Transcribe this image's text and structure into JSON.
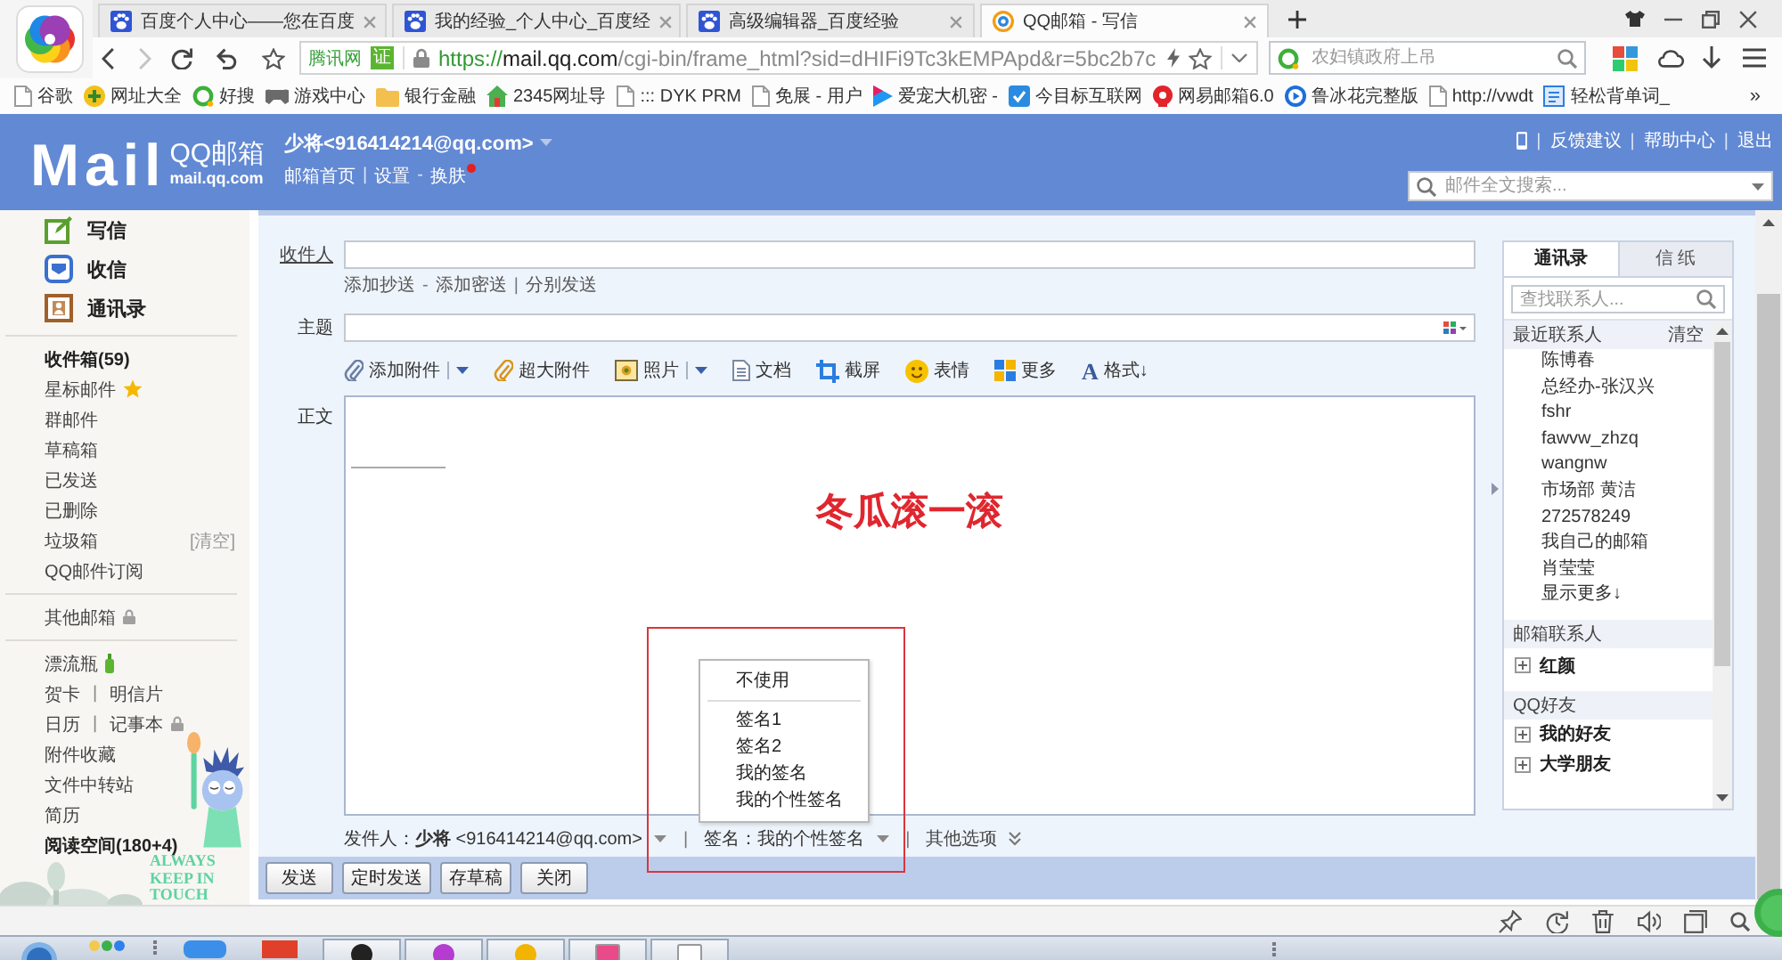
{
  "browser": {
    "tabs": [
      {
        "title": "百度个人中心——您在百度",
        "kind": "paw",
        "selected": false
      },
      {
        "title": "我的经验_个人中心_百度经",
        "kind": "paw",
        "selected": false
      },
      {
        "title": "高级编辑器_百度经验",
        "kind": "paw",
        "selected": false
      },
      {
        "title": "QQ邮箱 - 写信",
        "kind": "ring",
        "selected": true
      }
    ],
    "address": {
      "site_label": "腾讯网",
      "badge": "证",
      "scheme": "https://",
      "host": "mail.qq.com",
      "path": "/cgi-bin/frame_html?sid=dHIFi9Tc3kEMPApd&r=5bc2b7c"
    },
    "search": {
      "placeholder": "农妇镇政府上吊"
    },
    "bookmarks": [
      {
        "label": "谷歌",
        "kind": "page"
      },
      {
        "label": "网址大全",
        "kind": "plus"
      },
      {
        "label": "好搜",
        "kind": "ring"
      },
      {
        "label": "游戏中心",
        "kind": "gamepad"
      },
      {
        "label": "银行金融",
        "kind": "folder"
      },
      {
        "label": "2345网址导",
        "kind": "house"
      },
      {
        "label": "::: DYK PRM",
        "kind": "page"
      },
      {
        "label": "免展 - 用户",
        "kind": "page"
      },
      {
        "label": "爱宠大机密 -",
        "kind": "play"
      },
      {
        "label": "今目标互联网",
        "kind": "tile"
      },
      {
        "label": "网易邮箱6.0",
        "kind": "seal"
      },
      {
        "label": "鲁冰花完整版",
        "kind": "disc"
      },
      {
        "label": "http://vwdt",
        "kind": "page"
      },
      {
        "label": "轻松背单词_",
        "kind": "note"
      }
    ],
    "bookmarks_more": "»"
  },
  "mail_header": {
    "logo": "Mail",
    "brand": "QQ邮箱",
    "domain": "mail.qq.com",
    "account": "少将<916414214@qq.com>",
    "links": [
      {
        "label": "邮箱首页",
        "new": false
      },
      {
        "sep": "|"
      },
      {
        "label": "设置",
        "new": false
      },
      {
        "sep": "-"
      },
      {
        "label": "换肤",
        "new": true
      }
    ],
    "top_links": [
      {
        "sep": "|"
      },
      {
        "label": "反馈建议"
      },
      {
        "sep": "|"
      },
      {
        "label": "帮助中心"
      },
      {
        "sep": "|"
      },
      {
        "label": "退出"
      }
    ],
    "search": {
      "placeholder": "邮件全文搜索..."
    }
  },
  "sidebar": {
    "actions": [
      {
        "label": "写信",
        "kind": "pencil"
      },
      {
        "label": "收信",
        "kind": "inbox"
      },
      {
        "label": "通讯录",
        "kind": "card"
      }
    ],
    "groups": [
      [
        {
          "parts": [
            {
              "label": "收件箱(59)"
            }
          ],
          "kind": "plain",
          "unread": true
        },
        {
          "parts": [
            {
              "label": "星标邮件"
            }
          ],
          "kind": "star",
          "unread": false
        },
        {
          "parts": [
            {
              "label": "群邮件"
            }
          ],
          "kind": "plain",
          "unread": false
        },
        {
          "parts": [
            {
              "label": "草稿箱"
            }
          ],
          "kind": "plain",
          "unread": false
        },
        {
          "parts": [
            {
              "label": "已发送"
            }
          ],
          "kind": "plain",
          "unread": false
        },
        {
          "parts": [
            {
              "label": "已删除"
            }
          ],
          "kind": "plain",
          "unread": false
        },
        {
          "parts": [
            {
              "label": "垃圾箱"
            }
          ],
          "kind": "plain",
          "unread": false,
          "action": "[清空]"
        },
        {
          "parts": [
            {
              "label": "QQ邮件订阅"
            }
          ],
          "kind": "plain",
          "unread": false
        }
      ],
      [
        {
          "parts": [
            {
              "label": "其他邮箱"
            }
          ],
          "kind": "lock",
          "unread": false
        }
      ],
      [
        {
          "parts": [
            {
              "label": "漂流瓶"
            }
          ],
          "kind": "bottle",
          "unread": false
        },
        {
          "parts": [
            {
              "label": "贺卡"
            },
            {
              "sep": "|"
            },
            {
              "label": "明信片"
            }
          ],
          "kind": "plain",
          "unread": false
        },
        {
          "parts": [
            {
              "label": "日历"
            },
            {
              "sep": "|"
            },
            {
              "label": "记事本"
            }
          ],
          "kind": "lock",
          "unread": false
        },
        {
          "parts": [
            {
              "label": "附件收藏"
            }
          ],
          "kind": "plain",
          "unread": false
        },
        {
          "parts": [
            {
              "label": "文件中转站"
            }
          ],
          "kind": "plain",
          "unread": false
        },
        {
          "parts": [
            {
              "label": "简历"
            }
          ],
          "kind": "plain",
          "unread": false
        },
        {
          "parts": [
            {
              "label": "阅读空间(180+4)"
            }
          ],
          "kind": "plain",
          "unread": true
        }
      ]
    ],
    "slogan": "ALWAYS KEEP IN TOUCH"
  },
  "compose": {
    "to_label": "收件人",
    "cc_links": [
      {
        "label": "添加抄送"
      },
      {
        "sep": "-"
      },
      {
        "label": "添加密送"
      },
      {
        "sep": "|"
      },
      {
        "label": "分别发送"
      }
    ],
    "subject_label": "主题",
    "toolbar": [
      {
        "label": "添加附件",
        "kind": "clip",
        "menu": true
      },
      {
        "label": "超大附件",
        "kind": "big-clip",
        "menu": false
      },
      {
        "label": "照片",
        "kind": "photo",
        "menu": true
      },
      {
        "label": "文档",
        "kind": "doc",
        "menu": false
      },
      {
        "label": "截屏",
        "kind": "capture",
        "menu": false
      },
      {
        "label": "表情",
        "kind": "smiley",
        "menu": false
      },
      {
        "label": "更多",
        "kind": "tiles",
        "menu": false
      },
      {
        "label": "格式↓",
        "kind": "glyph",
        "glyph": "A",
        "menu": false
      }
    ],
    "body_label": "正文",
    "body_text": "冬瓜滚一滚",
    "signature_menu": {
      "open": true,
      "groups": [
        [
          "不使用"
        ],
        [
          "签名1",
          "签名2",
          "我的签名",
          "我的个性签名"
        ]
      ]
    },
    "sender_row": [
      {
        "kind": "select",
        "label": "发件人：**少将** <916414214@qq.com>"
      },
      {
        "kind": "sep",
        "label": "|"
      },
      {
        "kind": "select",
        "label": "签名：我的个性签名"
      },
      {
        "kind": "sep",
        "label": "|"
      },
      {
        "kind": "more",
        "label": "其他选项"
      }
    ],
    "buttons": [
      "发送",
      "定时发送",
      "存草稿",
      "关闭"
    ]
  },
  "contacts": {
    "tabs": [
      {
        "label": "通讯录",
        "selected": true
      },
      {
        "label": "信 纸",
        "selected": false
      }
    ],
    "search_placeholder": "查找联系人...",
    "recent": {
      "title": "最近联系人",
      "action": "清空",
      "names": [
        "陈博春",
        "总经办-张汉兴",
        "fshr",
        "fawvw_zhzq",
        "wangnw",
        "市场部 黄洁",
        "272578249",
        "我自己的邮箱",
        "肖莹莹"
      ],
      "more": "显示更多↓"
    },
    "groups": [
      {
        "title": "邮箱联系人",
        "items": [
          {
            "label": "红颜",
            "expanded": false
          }
        ]
      },
      {
        "title": "QQ好友",
        "items": [
          {
            "label": "我的好友",
            "expanded": false
          },
          {
            "label": "大学朋友",
            "expanded": false
          }
        ]
      }
    ]
  }
}
